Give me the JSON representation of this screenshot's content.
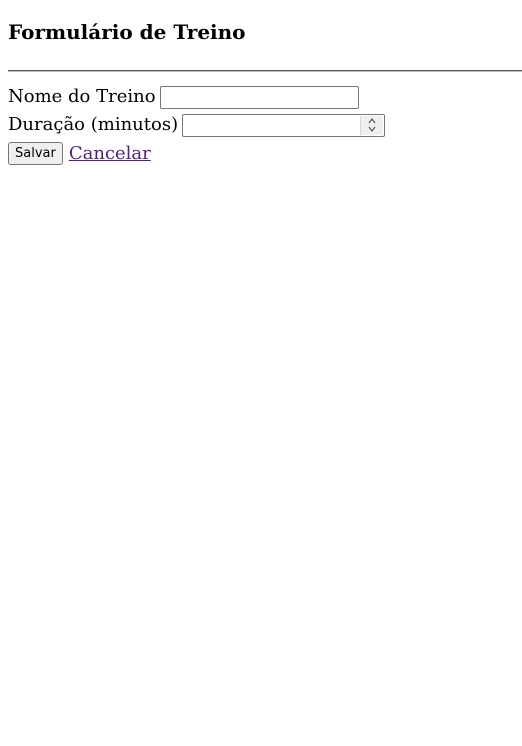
{
  "page": {
    "title": "Formulário de Treino"
  },
  "form": {
    "name_field": {
      "label": "Nome do Treino",
      "value": "",
      "placeholder": ""
    },
    "duration_field": {
      "label": "Duração (minutos)",
      "value": "",
      "placeholder": ""
    },
    "actions": {
      "save_label": "Salvar",
      "cancel_label": "Cancelar"
    }
  },
  "colors": {
    "link_visited": "#551a8b",
    "button_bg": "#efefef",
    "input_border": "#767676"
  },
  "icons": {
    "spinner": "up-down-chevron-icon"
  }
}
